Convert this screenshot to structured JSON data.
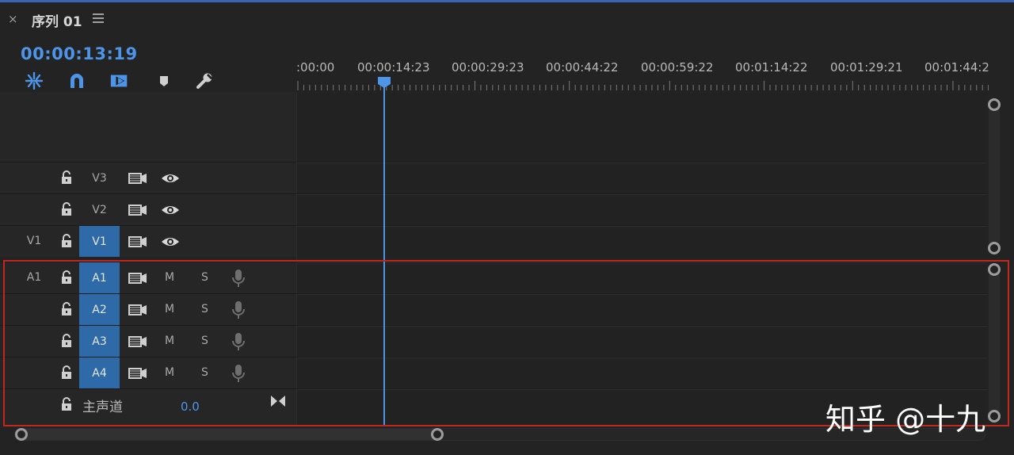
{
  "panel": {
    "close_glyph": "×",
    "title": "序列 01",
    "menu_icon": "hamburger-icon"
  },
  "timecode": "00:00:13:19",
  "toolbar": {
    "tools": [
      "snap-in-sequence-icon",
      "magnet-snap-icon",
      "linked-selection-icon",
      "add-marker-icon",
      "wrench-settings-icon"
    ]
  },
  "ruler": {
    "labels": [
      ":00:00",
      "00:00:14:23",
      "00:00:29:23",
      "00:00:44:22",
      "00:00:59:22",
      "00:01:14:22",
      "00:01:29:21",
      "00:01:44:2"
    ]
  },
  "playhead": {
    "timecode": "00:00:13:19"
  },
  "video_tracks": [
    {
      "source": "",
      "target": "V3",
      "target_on": false,
      "icons": [
        "lock-icon",
        "sync-lock-icon",
        "eye-icon"
      ]
    },
    {
      "source": "",
      "target": "V2",
      "target_on": false,
      "icons": [
        "lock-icon",
        "sync-lock-icon",
        "eye-icon"
      ]
    },
    {
      "source": "V1",
      "target": "V1",
      "target_on": true,
      "icons": [
        "lock-icon",
        "sync-lock-icon",
        "eye-icon"
      ]
    }
  ],
  "audio_tracks": [
    {
      "source": "A1",
      "target": "A1",
      "target_on": true,
      "mute": "M",
      "solo": "S"
    },
    {
      "source": "",
      "target": "A2",
      "target_on": true,
      "mute": "M",
      "solo": "S"
    },
    {
      "source": "",
      "target": "A3",
      "target_on": true,
      "mute": "M",
      "solo": "S"
    },
    {
      "source": "",
      "target": "A4",
      "target_on": true,
      "mute": "M",
      "solo": "S"
    }
  ],
  "master": {
    "label": "主声道",
    "value": "0.0"
  },
  "highlight_color": "#c1261f",
  "accent_color": "#4d95e8",
  "watermark": "知乎 @十九"
}
